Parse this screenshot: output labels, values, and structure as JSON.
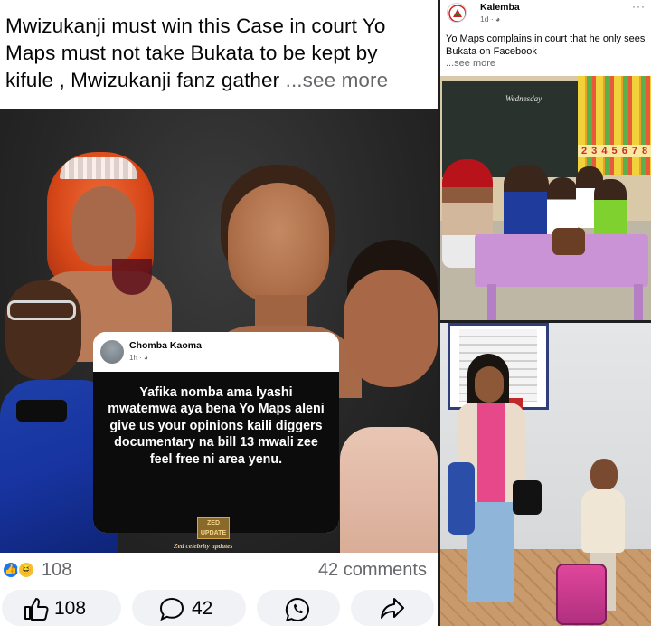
{
  "left_post": {
    "caption": "Mwizukanji must win this Case in court Yo Maps must not take Bukata to be kept by kifule , Mwizukanji fanz gather ",
    "see_more": "...see more",
    "inner_card": {
      "author": "Chomba Kaoma",
      "time": "1h · ",
      "text": "Yafika nomba ama lyashi mwatemwa aya bena Yo Maps aleni give us your opinions kaili diggers documentary na bill 13 mwali zee feel free ni area yenu."
    },
    "watermark": {
      "logo": "ZED UPDATE",
      "subtitle": "Zed celebrity updates"
    },
    "reactions": {
      "count": "108",
      "comments": "42 comments"
    },
    "actions": {
      "like_count": "108",
      "comment_count": "42"
    },
    "colors": {
      "like": "#1877f2",
      "haha": "#f7c031"
    }
  },
  "right_top_post": {
    "author": "Kalemba",
    "time": "1d · ",
    "menu": "···",
    "caption": "Yo Maps complains in court that he only sees Bukata on Facebook",
    "see_more": "...see more",
    "photo_board": "Wednesday",
    "photo_numbers": "2 3 4 5 6 7 8"
  }
}
